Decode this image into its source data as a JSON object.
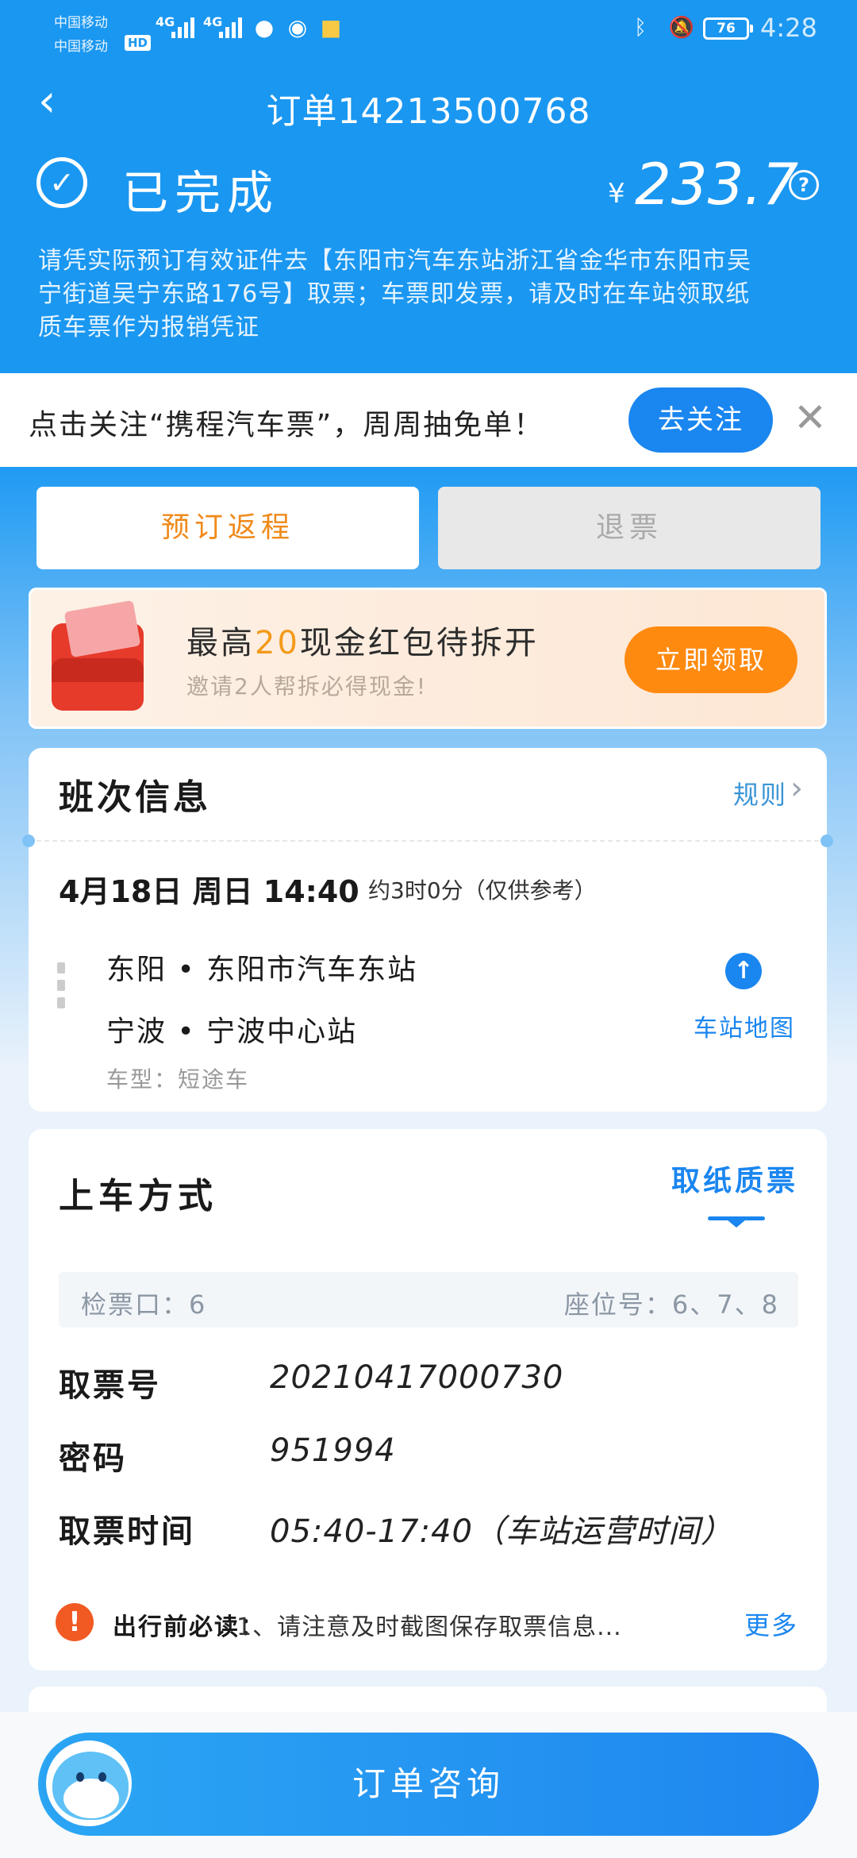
{
  "status_bar": {
    "carrier1": "中国移动",
    "carrier2": "中国移动",
    "hd": "HD",
    "net1": "4G",
    "net2": "4G",
    "battery": "76",
    "time": "4:28"
  },
  "header": {
    "title": "订单14213500768",
    "status": "已完成",
    "currency": "¥",
    "price": "233.7",
    "notice": "请凭实际预订有效证件去【东阳市汽车东站浙江省金华市东阳市吴宁街道吴宁东路176号】取票；车票即发票，请及时在车站领取纸质车票作为报销凭证"
  },
  "follow_banner": {
    "text": "点击关注“携程汽车票”，周周抽免单！",
    "button": "去关注"
  },
  "actions": {
    "return_trip": "预订返程",
    "refund": "退票"
  },
  "promo": {
    "title_prefix": "最高",
    "title_highlight": "20",
    "title_suffix": "现金红包待拆开",
    "subtitle": "邀请2人帮拆必得现金!",
    "button": "立即领取"
  },
  "trip_info": {
    "title": "班次信息",
    "rule": "规则",
    "date": "4月18日 周日 14:40",
    "duration": "约3时0分（仅供参考）",
    "from": "东阳 • 东阳市汽车东站",
    "to": "宁波 • 宁波中心站",
    "vehicle": "车型：短途车",
    "map_label": "车站地图"
  },
  "boarding": {
    "title": "上车方式",
    "tab": "取纸质票",
    "gate": "检票口：6",
    "seat": "座位号：6、7、8",
    "rows": [
      {
        "label": "取票号",
        "value": "20210417000730"
      },
      {
        "label": "密码",
        "value": "951994"
      },
      {
        "label": "取票时间",
        "value": "05:40-17:40（车站运营时间）"
      }
    ],
    "notice_label": "出行前必读：",
    "notice_text": "1、请注意及时截图保存取票信息...",
    "more": "更多"
  },
  "bottom": {
    "consult": "订单咨询"
  },
  "colors": {
    "primary": "#1a97f1",
    "accent_orange": "#ff8a10",
    "link_blue": "#1a86f0",
    "warning": "#f25a24"
  },
  "icons": {
    "back": "chevron-left-icon",
    "status": "check-circle-icon",
    "help": "question-icon",
    "close": "close-icon",
    "map": "navigation-icon",
    "warning": "exclamation-icon"
  }
}
